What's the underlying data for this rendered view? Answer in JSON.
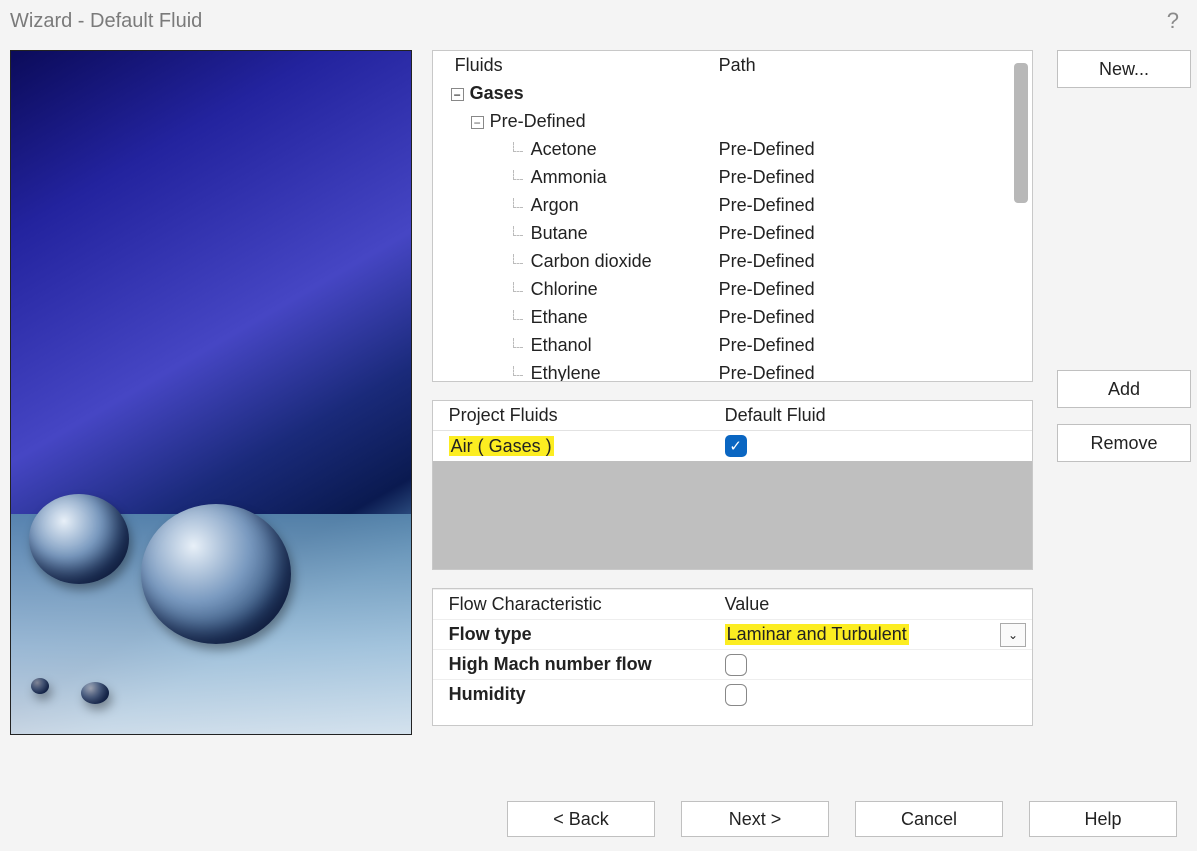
{
  "title": "Wizard - Default Fluid",
  "help_symbol": "?",
  "fluids_table": {
    "header": {
      "col1": "Fluids",
      "col2": "Path"
    },
    "category": "Gases",
    "subcategory": "Pre-Defined",
    "items": [
      {
        "name": "Acetone",
        "path": "Pre-Defined"
      },
      {
        "name": "Ammonia",
        "path": "Pre-Defined"
      },
      {
        "name": "Argon",
        "path": "Pre-Defined"
      },
      {
        "name": "Butane",
        "path": "Pre-Defined"
      },
      {
        "name": "Carbon dioxide",
        "path": "Pre-Defined"
      },
      {
        "name": "Chlorine",
        "path": "Pre-Defined"
      },
      {
        "name": "Ethane",
        "path": "Pre-Defined"
      },
      {
        "name": "Ethanol",
        "path": "Pre-Defined"
      },
      {
        "name": "Ethylene",
        "path": "Pre-Defined"
      }
    ]
  },
  "project_fluids": {
    "header": {
      "col1": "Project Fluids",
      "col2": "Default Fluid"
    },
    "row": {
      "name": "Air ( Gases )",
      "checked": true
    }
  },
  "flow": {
    "header": {
      "col1": "Flow Characteristic",
      "col2": "Value"
    },
    "rows": [
      {
        "label": "Flow type",
        "value": "Laminar and Turbulent",
        "kind": "combo",
        "highlight": true
      },
      {
        "label": "High Mach number flow",
        "kind": "check",
        "checked": false
      },
      {
        "label": "Humidity",
        "kind": "check",
        "checked": false
      }
    ]
  },
  "buttons": {
    "new": "New...",
    "add": "Add",
    "remove": "Remove",
    "back": "< Back",
    "next": "Next >",
    "cancel": "Cancel",
    "help": "Help"
  }
}
